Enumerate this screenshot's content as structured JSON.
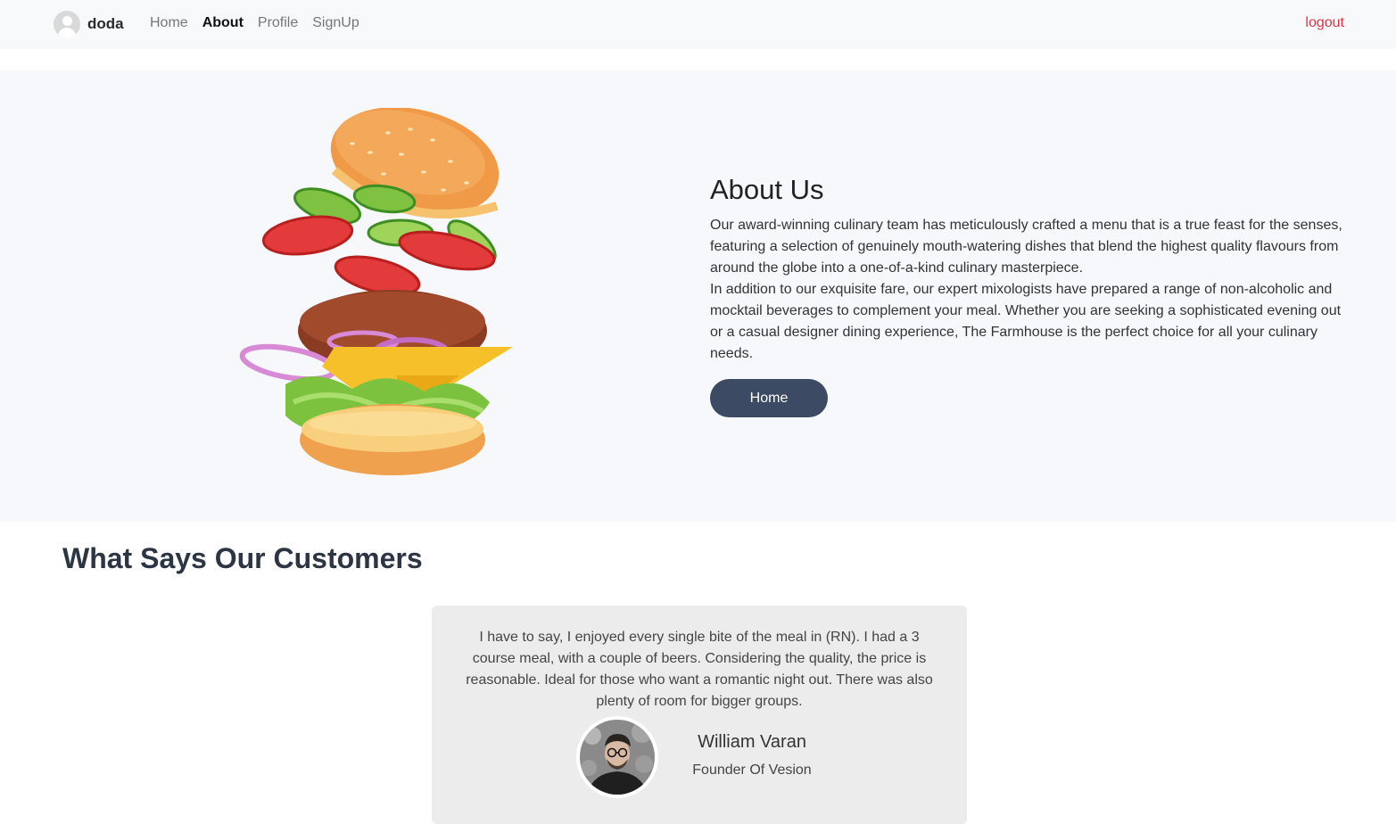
{
  "navbar": {
    "username": "doda",
    "links": [
      {
        "label": "Home",
        "active": false
      },
      {
        "label": "About",
        "active": true
      },
      {
        "label": "Profile",
        "active": false
      },
      {
        "label": "SignUp",
        "active": false
      }
    ],
    "logout_label": "logout",
    "logout_color": "#dc3545"
  },
  "hero": {
    "image_icon": "burger-illustration",
    "title": "About Us",
    "paragraph1": "Our award-winning culinary team has meticulously crafted a menu that is a true feast for the senses, featuring a selection of genuinely mouth-watering dishes that blend the highest quality flavours from around the globe into a one-of-a-kind culinary masterpiece.",
    "paragraph2": "In addition to our exquisite fare, our expert mixologists have prepared a range of non-alcoholic and mocktail beverages to complement your meal. Whether you are seeking a sophisticated evening out or a casual designer dining experience, The Farmhouse is the perfect choice for all your culinary needs.",
    "button_label": "Home",
    "button_color": "#3d4a63"
  },
  "testimonials": {
    "title": "What Says Our Customers",
    "items": [
      {
        "quote": "I have to say, I enjoyed every single bite of the meal in (RN). I had a 3 course meal, with a couple of beers. Considering the quality, the price is reasonable. Ideal for those who want a romantic night out. There was also plenty of room for bigger groups.",
        "name": "William Varan",
        "role": "Founder Of Vesion"
      }
    ]
  }
}
